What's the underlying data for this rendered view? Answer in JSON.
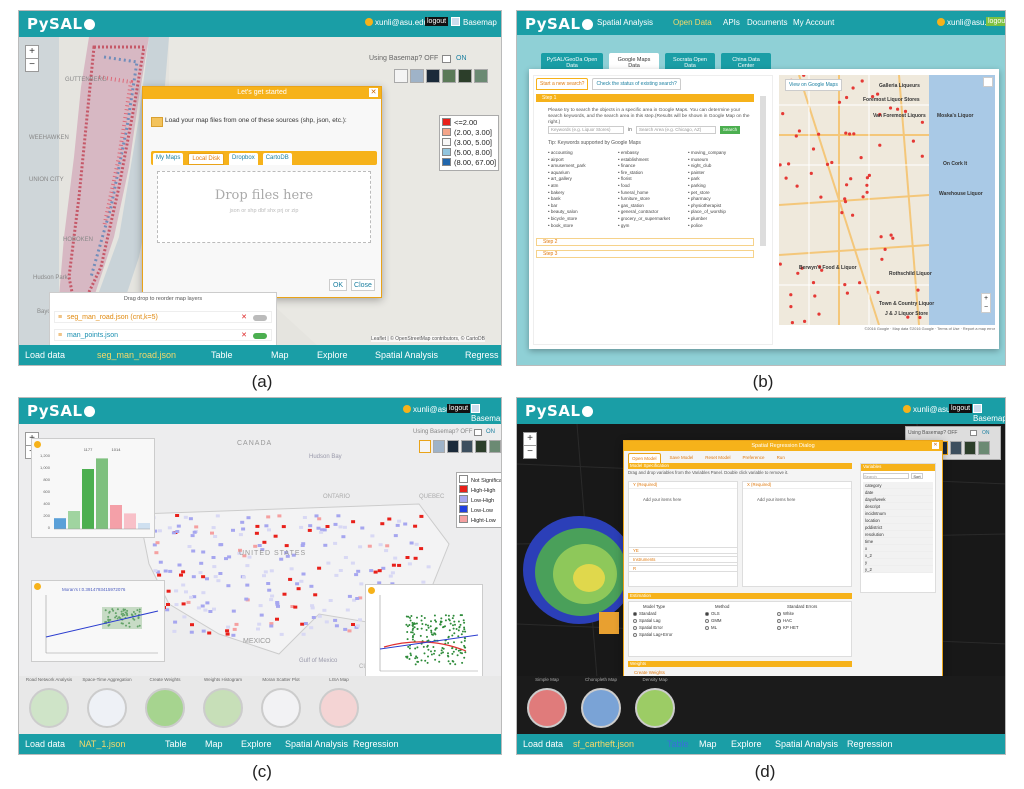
{
  "captions": [
    "(a)",
    "(b)",
    "(c)",
    "(d)"
  ],
  "app": {
    "logo": "PySAL",
    "user": "xunli@asu.edu",
    "logout": "logout",
    "basemap": "Basemap"
  },
  "footer_a": [
    "Load data",
    "seg_man_road.json",
    "Table",
    "Map",
    "Explore",
    "Spatial Analysis",
    "Regress"
  ],
  "footer_c": [
    "Load data",
    "NAT_1.json",
    "Table",
    "Map",
    "Explore",
    "Spatial Analysis",
    "Regression"
  ],
  "footer_d": [
    "Load data",
    "sf_cartheft.json",
    "Table",
    "Map",
    "Explore",
    "Spatial Analysis",
    "Regression"
  ],
  "panel_a": {
    "basemap_toggle": "Using Basemap? OFF",
    "basemap_on": "ON",
    "dialog_title": "Let's get started",
    "dialog_text": "Load your map files from one of these sources (shp, json, etc.):",
    "tabs": [
      "My Maps",
      "Local Disk",
      "Dropbox",
      "CartoDB"
    ],
    "drop_title": "Drop files here",
    "drop_sub": "json or shp dbf shx prj or zip",
    "ok": "OK",
    "close": "Close",
    "legend": [
      {
        "label": "<=2.00",
        "color": "#e8201a"
      },
      {
        "label": "(2.00, 3.00]",
        "color": "#f4a58a"
      },
      {
        "label": "(3.00, 5.00]",
        "color": "#f7f7f7"
      },
      {
        "label": "(5.00, 8.00]",
        "color": "#92c5de"
      },
      {
        "label": "(8.00, 67.00]",
        "color": "#2166ac"
      }
    ],
    "layers_title": "Drag drop to reorder map layers",
    "layers": [
      "seg_man_road.json (cnt,k=5)",
      "man_points.json"
    ],
    "attribution": "Leaflet | © OpenStreetMap contributors, © CartoDB",
    "map_labels": [
      "GUTTENBERG",
      "WEEHAWKEN",
      "UNION CITY",
      "HOBOKEN",
      "Hudson Park",
      "Bayonne"
    ]
  },
  "panel_b": {
    "nav": [
      "Spatial Analysis",
      "Open Data",
      "APIs",
      "Documents",
      "My Account"
    ],
    "user": "xunli@asu.edu",
    "logout": "logout",
    "tabs": [
      "PySAL/GeoDa Open Data",
      "Google Maps Data",
      "Socrata Open Data",
      "China Data Center"
    ],
    "subtabs": [
      "Start a new search?",
      "Check the status of existing search?"
    ],
    "step1": "Step 1",
    "intro": "Please try to search the objects in a specific area in Google Maps. You can determine your search keywords, and the search area in this step.(Results will be shown in Google Map on the right.)",
    "keywords_ph": "Keywords (e.g. Liquor Stores)",
    "in": "in",
    "area_ph": "Search Area (e.g. Chicago, AZ)",
    "search": "Search",
    "tip": "Tip: Keywords supported by Google Maps",
    "kw_col1": [
      "accounting",
      "airport",
      "amusement_park",
      "aquarium",
      "art_gallery",
      "atm",
      "bakery",
      "bank",
      "bar",
      "beauty_salon",
      "bicycle_store",
      "book_store"
    ],
    "kw_col2": [
      "embassy",
      "establishment",
      "finance",
      "fire_station",
      "florist",
      "food",
      "funeral_home",
      "furniture_store",
      "gas_station",
      "general_contractor",
      "grocery_or_supermarket",
      "gym"
    ],
    "kw_col3": [
      "moving_company",
      "museum",
      "night_club",
      "painter",
      "park",
      "parking",
      "pet_store",
      "pharmacy",
      "physiotherapist",
      "place_of_worship",
      "plumber",
      "police"
    ],
    "step2": "Step 2",
    "step3": "Step 3",
    "view_google": "View on Google Maps",
    "places": [
      "Galleria Liqueurs",
      "Foremost Liquor Stores",
      "Van Foremost Liquors",
      "Moska's Liquor",
      "On Cork It",
      "Warehouse Liquor",
      "Berwyn's Food & Liquor",
      "Rothschild Liquor",
      "Town & Country Liquor",
      "J & J Liquor Store"
    ],
    "map_footer": "©2016 Google · Map data ©2016 Google · Terms of Use · Report a map error"
  },
  "panel_c": {
    "basemap_toggle": "Using Basemap? OFF",
    "basemap_on": "ON",
    "legend": [
      {
        "label": "Not Significant",
        "color": "#ffffff"
      },
      {
        "label": "High-High",
        "color": "#e8201a"
      },
      {
        "label": "Low-High",
        "color": "#a6a6ef"
      },
      {
        "label": "Low-Low",
        "color": "#1f3fe0"
      },
      {
        "label": "Hight-Low",
        "color": "#f5a0a0"
      }
    ],
    "moran_title": "Moran's I:0.3914793415972076",
    "map_labels": [
      "CANADA",
      "UNITED STATES",
      "MEXICO",
      "Gulf of Mexico",
      "Hudson Bay",
      "ONTARIO",
      "QUEBEC",
      "CUBA"
    ],
    "thumbs": [
      "Road Network Analysis",
      "Space-Time Aggregation",
      "Create Weights",
      "Weights Histogram",
      "Moran Scatter Plot",
      "LISA Map"
    ]
  },
  "panel_d": {
    "basemap_toggle": "Using Basemap? OFF",
    "basemap_on": "ON",
    "dialog_title": "Spatial Regression Dialog",
    "toolbar": [
      "Open Model",
      "Save Model",
      "Reset Model",
      "Preference",
      "Run"
    ],
    "spec_title": "Model Specification",
    "spec_help": "Drag and drop variables from the Variables Panel. Double click variable to remove it.",
    "y_label": "Y (Required)",
    "x_label": "X (Required)",
    "add_items": "Add your items here",
    "ye": "YE",
    "instruments": "Instruments",
    "r": "R",
    "variables_title": "Variables",
    "search_ph": "Search",
    "sort": "Sort",
    "variables": [
      "category",
      "date",
      "dayofweek",
      "descript",
      "incidntnum",
      "location",
      "pddistrict",
      "resolution",
      "time",
      "x",
      "x_2",
      "y",
      "y_2"
    ],
    "estimation_title": "Estimation",
    "model_type": "Model Type",
    "method": "Method",
    "std_errors": "Standard Errors",
    "model_types": [
      "Standard",
      "Spatial Lag",
      "Spatial Error",
      "Spatial Lag+Error"
    ],
    "methods": [
      "OLS",
      "GMM",
      "ML"
    ],
    "errors": [
      "White",
      "HAC",
      "KP HET"
    ],
    "weights_title": "Weights",
    "create_weights": "Create Weights",
    "thumbs": [
      "Simple Map",
      "Choropleth Map",
      "Density Map"
    ]
  },
  "chart_c_hist": {
    "values": [
      180,
      300,
      1000,
      1177,
      400,
      260,
      100
    ],
    "yticks": [
      "1,200",
      "1,000",
      "800",
      "600",
      "400",
      "200",
      "0"
    ],
    "top_labels": [
      "1177",
      "1014"
    ]
  }
}
